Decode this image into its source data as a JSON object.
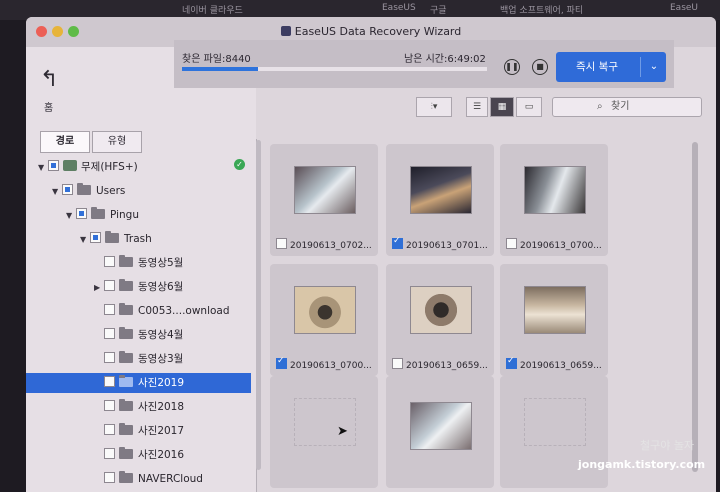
{
  "background_tabs": [
    "네이버 클라우드",
    "EaseUS",
    "구글",
    "백업 소프트웨어, 파티",
    "EaseU"
  ],
  "window": {
    "title": "EaseUS Data Recovery Wizard"
  },
  "nav": {
    "home_label": "홈"
  },
  "left_tabs": [
    {
      "label": "경로"
    },
    {
      "label": "유형"
    }
  ],
  "tree": [
    {
      "label": "무제(HFS+)"
    },
    {
      "label": "Users"
    },
    {
      "label": "Pingu"
    },
    {
      "label": "Trash"
    },
    {
      "label": "동영상5월"
    },
    {
      "label": "동영상6월"
    },
    {
      "label": "C0053....ownload"
    },
    {
      "label": "동영상4월"
    },
    {
      "label": "동영상3월"
    },
    {
      "label": "사진2019"
    },
    {
      "label": "사진2018"
    },
    {
      "label": "사진2017"
    },
    {
      "label": "사진2016"
    },
    {
      "label": "NAVERCloud"
    }
  ],
  "scan": {
    "found_label": "찾은 파일:8440",
    "remaining_label": "남은 시간:6:49:02",
    "progress": 0.25
  },
  "actions": {
    "recover_label": "즉시 복구"
  },
  "search": {
    "placeholder": "찾기"
  },
  "files": [
    {
      "name": "20190613_0702...",
      "checked": false
    },
    {
      "name": "20190613_0701...",
      "checked": true
    },
    {
      "name": "20190613_0700...",
      "checked": false
    },
    {
      "name": "20190613_0700...",
      "checked": true
    },
    {
      "name": "20190613_0659...",
      "checked": false
    },
    {
      "name": "20190613_0659...",
      "checked": true
    }
  ],
  "watermark": {
    "line1": "철구야 놀자",
    "line2": "jongamk.tistory.com"
  },
  "colors": {
    "accent": "#2f6bd8",
    "selection": "#2f68d6",
    "ok": "#3aa755"
  }
}
